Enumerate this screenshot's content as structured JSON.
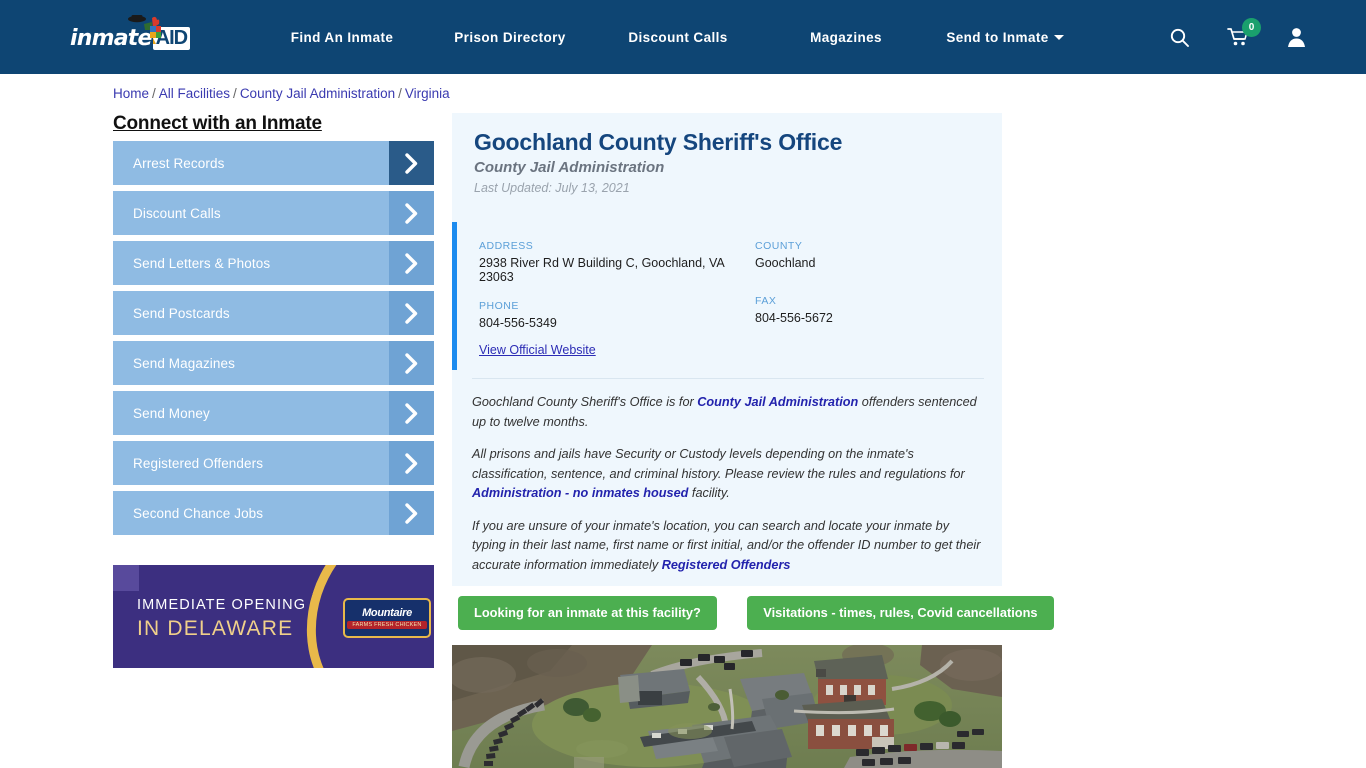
{
  "header": {
    "logo_text": "inmate",
    "logo_badge": "AID",
    "logo_icon": "rooster-logo-icon",
    "nav": [
      {
        "label": "Find An Inmate",
        "name": "nav-find-an-inmate"
      },
      {
        "label": "Prison Directory",
        "name": "nav-prison-directory"
      },
      {
        "label": "Discount Calls",
        "name": "nav-discount-calls"
      },
      {
        "label": "Magazines",
        "name": "nav-magazines"
      },
      {
        "label": "Send to Inmate",
        "name": "nav-send-to-inmate",
        "has_caret": true
      }
    ],
    "icons": {
      "search": "search-icon",
      "cart": "shopping-cart-icon",
      "cart_count": "0",
      "account": "user-account-icon"
    }
  },
  "breadcrumb": {
    "items": [
      "Home",
      "All Facilities",
      "County Jail Administration",
      "Virginia"
    ],
    "separator": "/"
  },
  "sidebar": {
    "title": "Connect with an Inmate",
    "items": [
      {
        "label": "Arrest Records",
        "active": true
      },
      {
        "label": "Discount Calls",
        "active": false
      },
      {
        "label": "Send Letters & Photos",
        "active": false
      },
      {
        "label": "Send Postcards",
        "active": false
      },
      {
        "label": "Send Magazines",
        "active": false
      },
      {
        "label": "Send Money",
        "active": false
      },
      {
        "label": "Registered Offenders",
        "active": false
      },
      {
        "label": "Second Chance Jobs",
        "active": false
      }
    ]
  },
  "ad": {
    "line1": "IMMEDIATE OPENING",
    "line2": "IN DELAWARE",
    "brand": "Mountaire",
    "brand_sub": "FARMS FRESH CHICKEN"
  },
  "facility": {
    "title": "Goochland County Sheriff's Office",
    "subtitle": "County Jail Administration",
    "last_updated": "Last Updated: July 13, 2021",
    "fields": {
      "address_label": "ADDRESS",
      "address_value": "2938 River Rd W Building C, Goochland, VA 23063",
      "county_label": "COUNTY",
      "county_value": "Goochland",
      "phone_label": "PHONE",
      "phone_value": "804-556-5349",
      "fax_label": "FAX",
      "fax_value": "804-556-5672"
    },
    "official_website_link": "View Official Website",
    "paragraphs": [
      {
        "parts": [
          {
            "t": "Goochland County Sheriff's Office is for ",
            "link": false
          },
          {
            "t": "County Jail Administration",
            "link": true
          },
          {
            "t": " offenders sentenced up to twelve months.",
            "link": false
          }
        ]
      },
      {
        "parts": [
          {
            "t": "All prisons and jails have Security or Custody levels depending on the inmate's classification, sentence, and criminal history. Please review the rules and regulations for ",
            "link": false
          },
          {
            "t": "Administration - no inmates housed",
            "link": true
          },
          {
            "t": " facility.",
            "link": false
          }
        ]
      },
      {
        "parts": [
          {
            "t": "If you are unsure of your inmate's location, you can search and locate your inmate by typing in their last name, first name or first initial, and/or the offender ID number to get their accurate information immediately ",
            "link": false
          },
          {
            "t": "Registered Offenders",
            "link": true
          }
        ]
      }
    ]
  },
  "cta_buttons": [
    {
      "label": "Looking for an inmate at this facility?",
      "name": "looking-for-inmate-button"
    },
    {
      "label": "Visitations - times, rules, Covid cancellations",
      "name": "visitations-button"
    }
  ],
  "aerial_photo": {
    "name": "facility-aerial-photo",
    "alt": "Aerial view of Goochland County Sheriff's Office campus"
  },
  "colors": {
    "header_blue": "#0e4573",
    "accent_blue": "#1c8bef",
    "title_blue": "#15467e",
    "sidebar_blue": "#8fbbe3",
    "sidebar_arrow": "#6fa3d4",
    "sidebar_arrow_active": "#2a5b89",
    "cta_green": "#4caf50",
    "badge_green": "#1aa06d",
    "panel_bg": "#eff7fd",
    "link_blue": "#2323ad"
  }
}
